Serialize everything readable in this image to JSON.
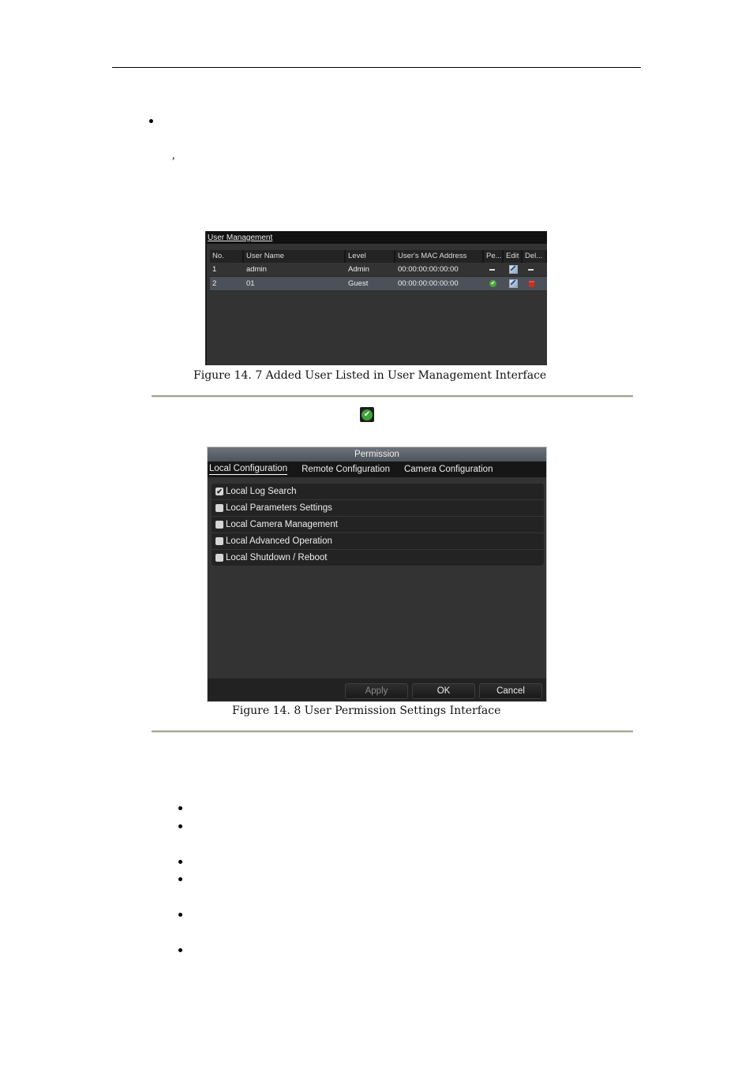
{
  "document": {
    "figure_14_7_caption": "Figure 14. 7 Added User Listed in User Management Interface",
    "figure_14_8_caption": "Figure 14. 8 User Permission Settings Interface",
    "stray_comma": ",",
    "inline_icon": "check-circle-icon"
  },
  "user_management": {
    "title": "User Management",
    "columns": [
      "No.",
      "User Name",
      "Level",
      "User's MAC Address",
      "Pe...",
      "Edit",
      "Del..."
    ],
    "rows": [
      {
        "no": "1",
        "user_name": "admin",
        "level": "Admin",
        "mac": "00:00:00:00:00:00",
        "permission_icon": "dash-icon",
        "edit_icon": "edit-icon",
        "delete_icon": "dash-icon",
        "selected": false
      },
      {
        "no": "2",
        "user_name": "01",
        "level": "Guest",
        "mac": "00:00:00:00:00:00",
        "permission_icon": "check-circle-icon",
        "edit_icon": "edit-icon",
        "delete_icon": "trash-icon",
        "selected": true
      }
    ]
  },
  "permission": {
    "title": "Permission",
    "tabs": [
      {
        "label": "Local Configuration",
        "active": true
      },
      {
        "label": "Remote Configuration",
        "active": false
      },
      {
        "label": "Camera Configuration",
        "active": false
      }
    ],
    "items": [
      {
        "label": "Local Log Search",
        "checked": true
      },
      {
        "label": "Local Parameters Settings",
        "checked": false
      },
      {
        "label": "Local Camera Management",
        "checked": false
      },
      {
        "label": "Local Advanced Operation",
        "checked": false
      },
      {
        "label": "Local Shutdown / Reboot",
        "checked": false
      }
    ],
    "buttons": {
      "apply": "Apply",
      "ok": "OK",
      "cancel": "Cancel"
    },
    "check_glyph": "✔"
  },
  "colors": {
    "window_bg": "#333333",
    "selected_row": "#4c5058",
    "green_check": "#3da23a",
    "delete_red": "#d9281c",
    "separator": "#a2a293"
  }
}
